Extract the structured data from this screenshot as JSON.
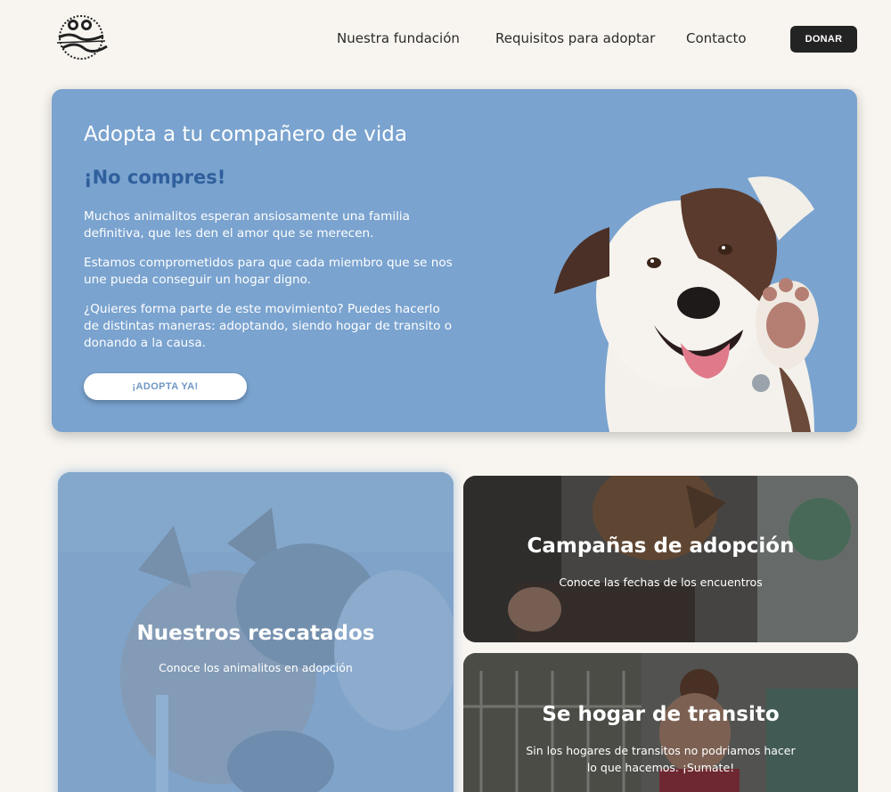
{
  "header": {
    "logo_alt": "Yo Adopto",
    "nav": [
      {
        "label": "Nuestra fundación"
      },
      {
        "label": "Requisitos para adoptar"
      },
      {
        "label": "Contacto"
      }
    ],
    "donate_label": "DONAR"
  },
  "hero": {
    "title": "Adopta a tu compañero de vida",
    "subtitle": "¡No compres!",
    "paragraphs": [
      "Muchos animalitos esperan ansiosamente una familia definitiva, que les den el amor que se merecen.",
      "Estamos comprometidos para que cada miembro que se nos une pueda conseguir un hogar digno.",
      "¿Quieres forma parte de este movimiento? Puedes hacerlo de distintas maneras: adoptando, siendo hogar de transito o donando a la causa."
    ],
    "cta_label": "¡ADOPTA YA!"
  },
  "cards": [
    {
      "title": "Nuestros rescatados",
      "text": "Conoce los animalitos en adopción"
    },
    {
      "title": "Campañas de adopción",
      "text": "Conoce las fechas de los encuentros"
    },
    {
      "title": "Se hogar de transito",
      "text": "Sin los hogares de transitos no podriamos hacer lo que hacemos. ¡Sumate!"
    }
  ],
  "colors": {
    "hero_bg": "#7aa3cf",
    "subtitle": "#2f5f9c",
    "page_bg": "#f8f5f0",
    "donate_bg": "#232323"
  }
}
